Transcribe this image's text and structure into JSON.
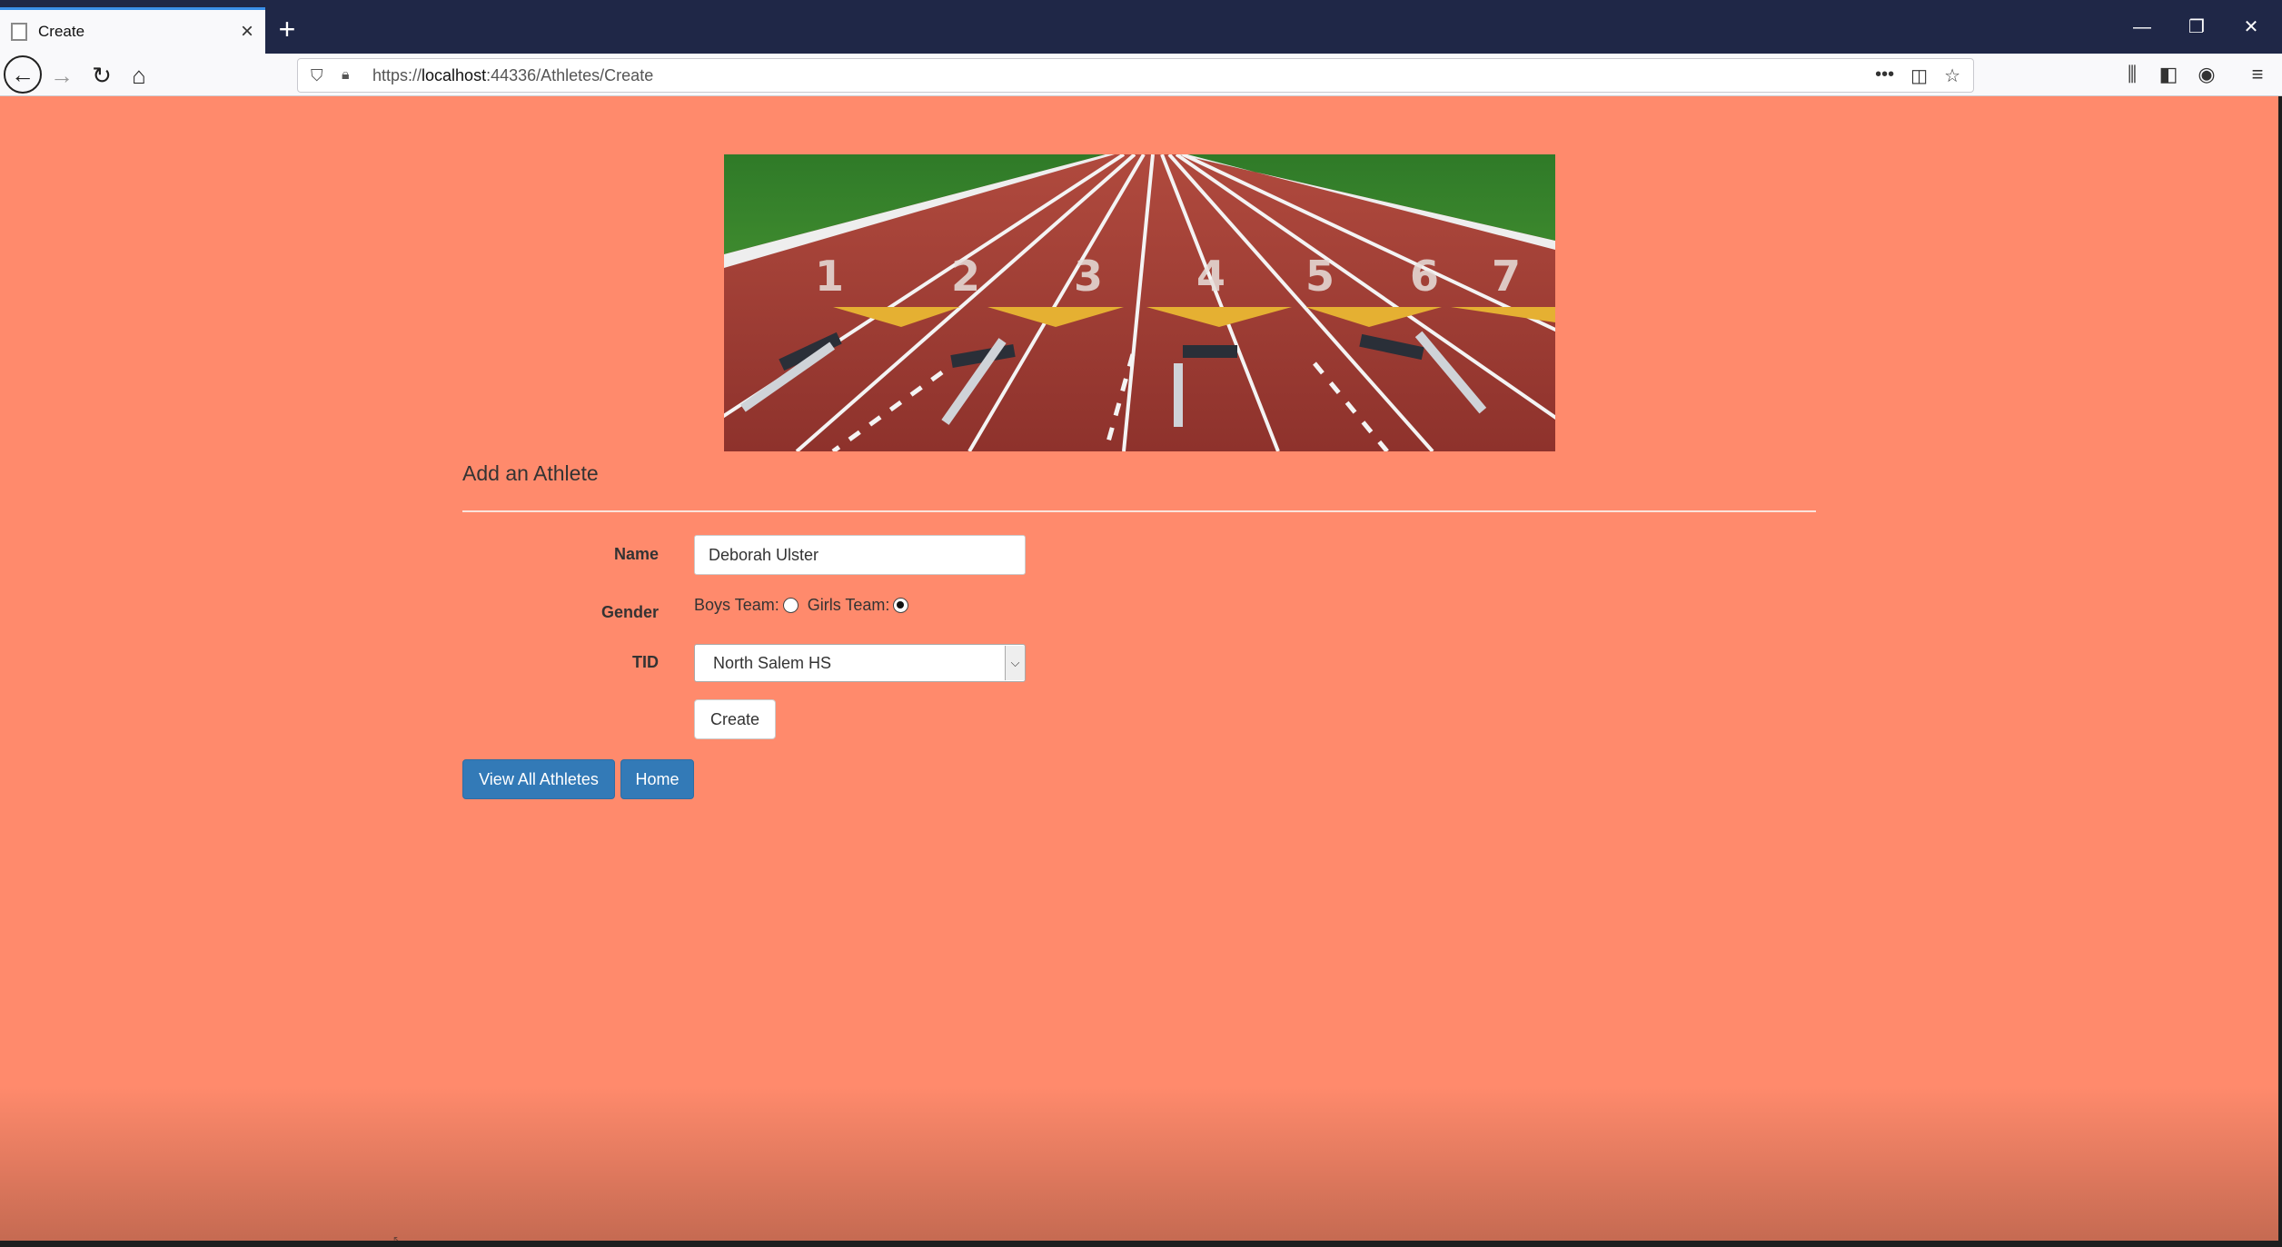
{
  "browser": {
    "tab_title": "Create",
    "new_tab_icon": "+",
    "url_prefix": "https://",
    "url_host": "localhost",
    "url_rest": ":44336/Athletes/Create",
    "window_controls": [
      "minimize-icon",
      "restore-icon",
      "close-icon"
    ]
  },
  "page": {
    "background": "#ff8a6c",
    "form_title": "Add an Athlete",
    "name_label": "Name",
    "name_value": "Deborah Ulster",
    "gender_label": "Gender",
    "boys_team_label": "Boys Team:",
    "girls_team_label": "Girls Team:",
    "gender_selected": "Girls Team",
    "tid_label": "TID",
    "tid_selected": "North Salem HS",
    "create_label": "Create",
    "view_all_label": "View All Athletes",
    "home_label": "Home",
    "lane_numbers": [
      "1",
      "2",
      "3",
      "4",
      "5",
      "6",
      "7"
    ]
  },
  "colors": {
    "primary_button": "#337ab7",
    "track": "#9e3b35",
    "grass": "#3f8f2f"
  }
}
